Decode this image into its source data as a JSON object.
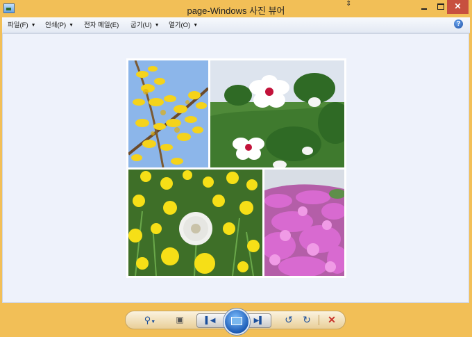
{
  "window": {
    "title": "page-Windows 사진 뷰어",
    "controls": {
      "minimize": "minimize-icon",
      "maximize": "maximize-icon",
      "close": "✕"
    }
  },
  "menu": {
    "items": [
      {
        "label": "파일(F)",
        "has_dropdown": true
      },
      {
        "label": "인쇄(P)",
        "has_dropdown": true
      },
      {
        "label": "전자 메일(E)",
        "has_dropdown": false
      },
      {
        "label": "굽기(U)",
        "has_dropdown": true
      },
      {
        "label": "열기(O)",
        "has_dropdown": true
      }
    ],
    "dropdown_arrow": "▼",
    "help": "?"
  },
  "photo": {
    "panels": [
      {
        "subject": "yellow forsythia blossoms"
      },
      {
        "subject": "white hibiscus flowers"
      },
      {
        "subject": "dandelions and seed head"
      },
      {
        "subject": "pink azalea hillside"
      }
    ]
  },
  "toolbar": {
    "zoom": "zoom-icon",
    "fit": "actual-size-icon",
    "previous": "previous-icon",
    "slideshow": "slideshow-icon",
    "next": "next-icon",
    "rotate_ccw": "rotate-ccw-icon",
    "rotate_cw": "rotate-cw-icon",
    "delete": "delete-icon"
  },
  "colors": {
    "frame": "#f2bf57",
    "close": "#c7503f",
    "viewer_bg": "#eef2fb",
    "accent": "#1b4f9c"
  }
}
